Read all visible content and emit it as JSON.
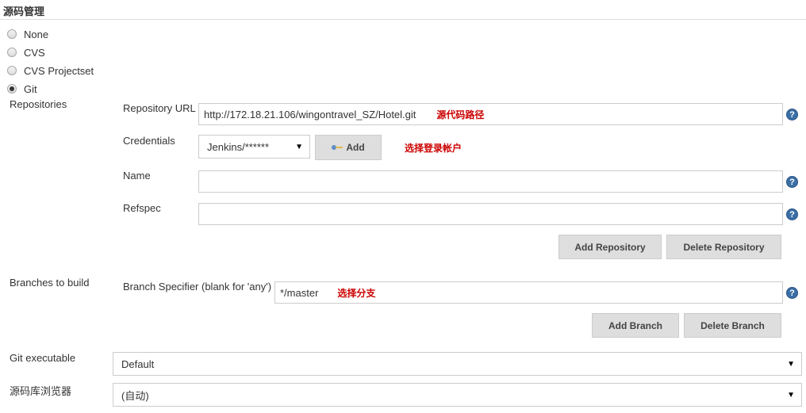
{
  "section": {
    "title": "源码管理"
  },
  "scm_options": [
    {
      "label": "None",
      "checked": false
    },
    {
      "label": "CVS",
      "checked": false
    },
    {
      "label": "CVS Projectset",
      "checked": false
    },
    {
      "label": "Git",
      "checked": true
    }
  ],
  "repositories": {
    "label": "Repositories",
    "url_label": "Repository URL",
    "url_value": "http://172.18.21.106/wingontravel_SZ/Hotel.git",
    "url_note": "源代码路径",
    "credentials_label": "Credentials",
    "credentials_value": "Jenkins/******",
    "add_label": "Add",
    "credentials_note": "选择登录帐户",
    "name_label": "Name",
    "name_value": "",
    "refspec_label": "Refspec",
    "refspec_value": "",
    "add_repo_label": "Add Repository",
    "delete_repo_label": "Delete Repository"
  },
  "branches": {
    "label": "Branches to build",
    "specifier_label": "Branch Specifier (blank for 'any')",
    "specifier_value": "*/master",
    "specifier_note": "选择分支",
    "add_branch_label": "Add Branch",
    "delete_branch_label": "Delete Branch"
  },
  "git_executable": {
    "label": "Git executable",
    "value": "Default"
  },
  "repo_browser": {
    "label": "源码库浏览器",
    "value": "(自动)"
  },
  "help_glyph": "?",
  "colors": {
    "note": "#cc0000",
    "help": "#3a6ea5",
    "button_bg": "#dedede"
  }
}
